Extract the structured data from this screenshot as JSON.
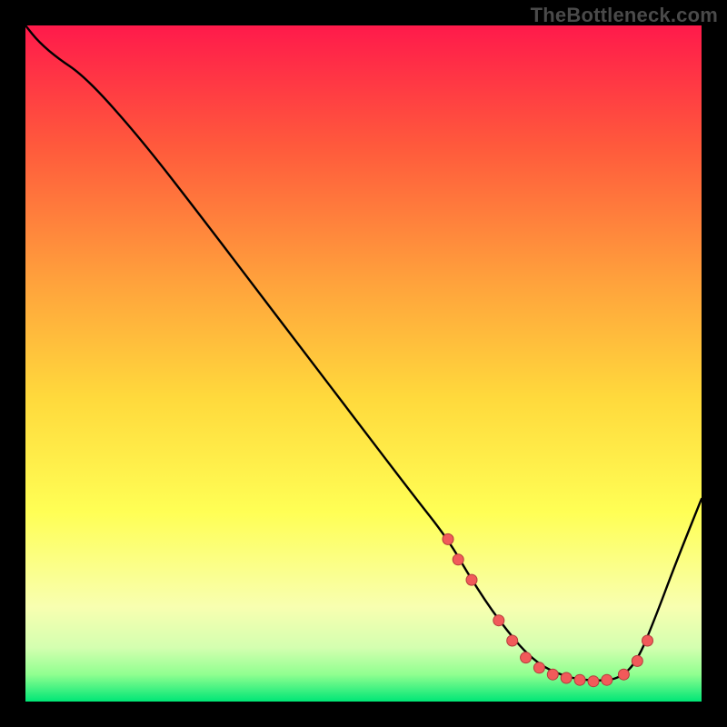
{
  "watermark": "TheBottleneck.com",
  "colors": {
    "frame": "#000000",
    "curve": "#000000",
    "dot_fill": "#f15a5a",
    "dot_stroke": "#b43c3c",
    "grad_top": "#ff1a4b",
    "grad_upper": "#ff5a3c",
    "grad_mid_high": "#ffa23c",
    "grad_mid": "#ffd93c",
    "grad_mid_low": "#ffff55",
    "grad_low1": "#f8ffb0",
    "grad_low2": "#d4ffb0",
    "grad_low3": "#90ff90",
    "grad_bottom": "#00e676"
  },
  "chart_data": {
    "type": "line",
    "title": "",
    "xlabel": "",
    "ylabel": "",
    "xlim": [
      0,
      100
    ],
    "ylim": [
      0,
      100
    ],
    "note": "Axes are unlabeled in the source image; coordinates are percentages of the plot area (0 = left/bottom, 100 = right/top).",
    "series": [
      {
        "name": "bottleneck-curve",
        "x": [
          0.0,
          2.0,
          5.0,
          8.0,
          12.0,
          18.0,
          25.0,
          33.0,
          41.0,
          49.0,
          57.0,
          62.5,
          66.0,
          70.0,
          75.0,
          80.0,
          85.0,
          88.0,
          90.5,
          93.0,
          96.0,
          100.0
        ],
        "y": [
          100.0,
          97.5,
          95.0,
          93.0,
          89.0,
          82.0,
          73.0,
          62.5,
          52.0,
          41.5,
          31.0,
          24.0,
          18.0,
          12.0,
          6.0,
          3.5,
          3.0,
          3.5,
          6.0,
          12.0,
          20.0,
          30.0
        ]
      }
    ],
    "highlight_points": {
      "name": "dots-along-valley",
      "x": [
        62.5,
        64.0,
        66.0,
        70.0,
        72.0,
        74.0,
        76.0,
        78.0,
        80.0,
        82.0,
        84.0,
        86.0,
        88.5,
        90.5,
        92.0
      ],
      "y": [
        24.0,
        21.0,
        18.0,
        12.0,
        9.0,
        6.5,
        5.0,
        4.0,
        3.5,
        3.2,
        3.0,
        3.2,
        4.0,
        6.0,
        9.0
      ]
    }
  }
}
